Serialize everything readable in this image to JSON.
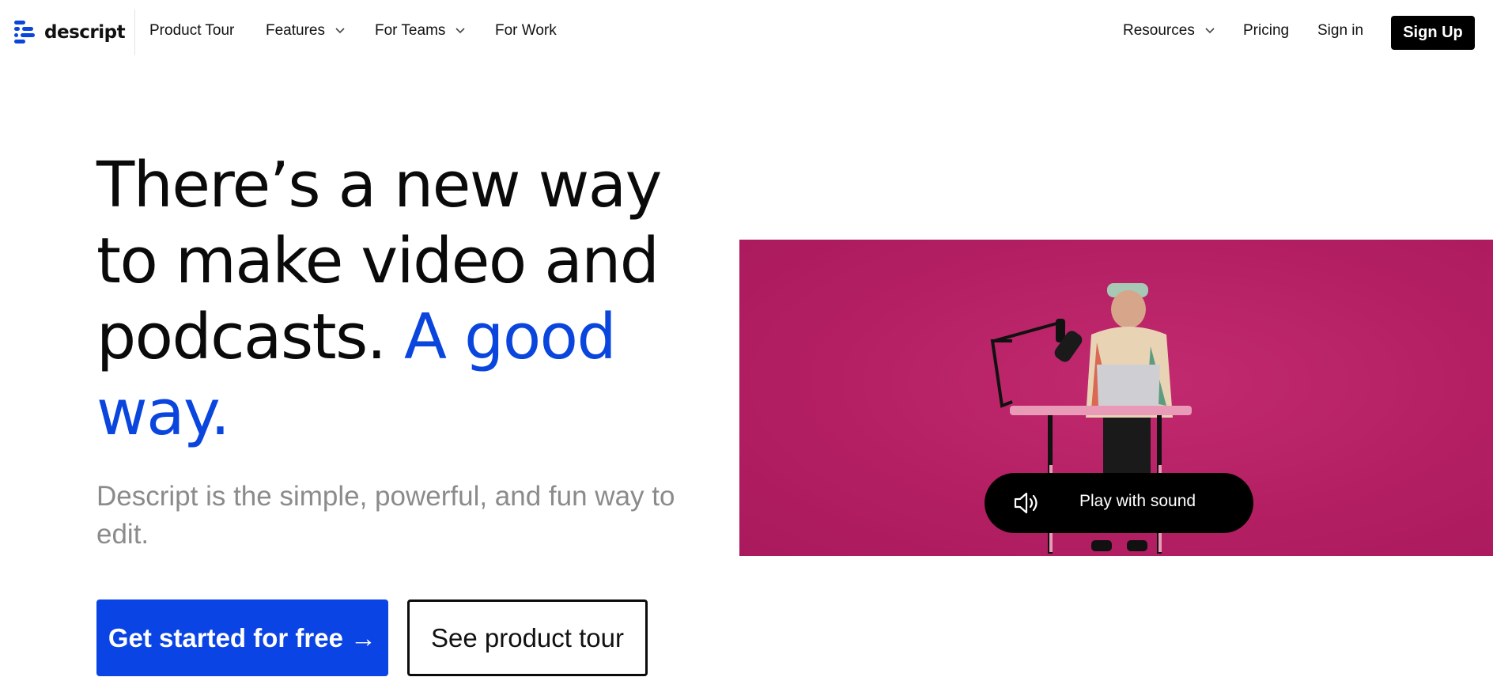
{
  "brand": {
    "name": "descript",
    "accent": "#0a45dd",
    "video_bg": "#b41f63"
  },
  "nav": {
    "left": [
      {
        "label": "Product Tour"
      },
      {
        "label": "Features"
      },
      {
        "label": "For Teams"
      },
      {
        "label": "For Work"
      }
    ],
    "right": {
      "resources": "Resources",
      "pricing": "Pricing",
      "signin": "Sign in",
      "signup": "Sign Up"
    }
  },
  "hero": {
    "headline_main": "There’s a new way to make video and podcasts.",
    "headline_accent": "A good way.",
    "subtitle": "Descript is the simple, powerful, and fun way to edit.",
    "cta_primary": "Get started for free →",
    "cta_secondary": "See product tour"
  },
  "video": {
    "play_label": "Play with sound",
    "icon": "speaker-icon"
  }
}
